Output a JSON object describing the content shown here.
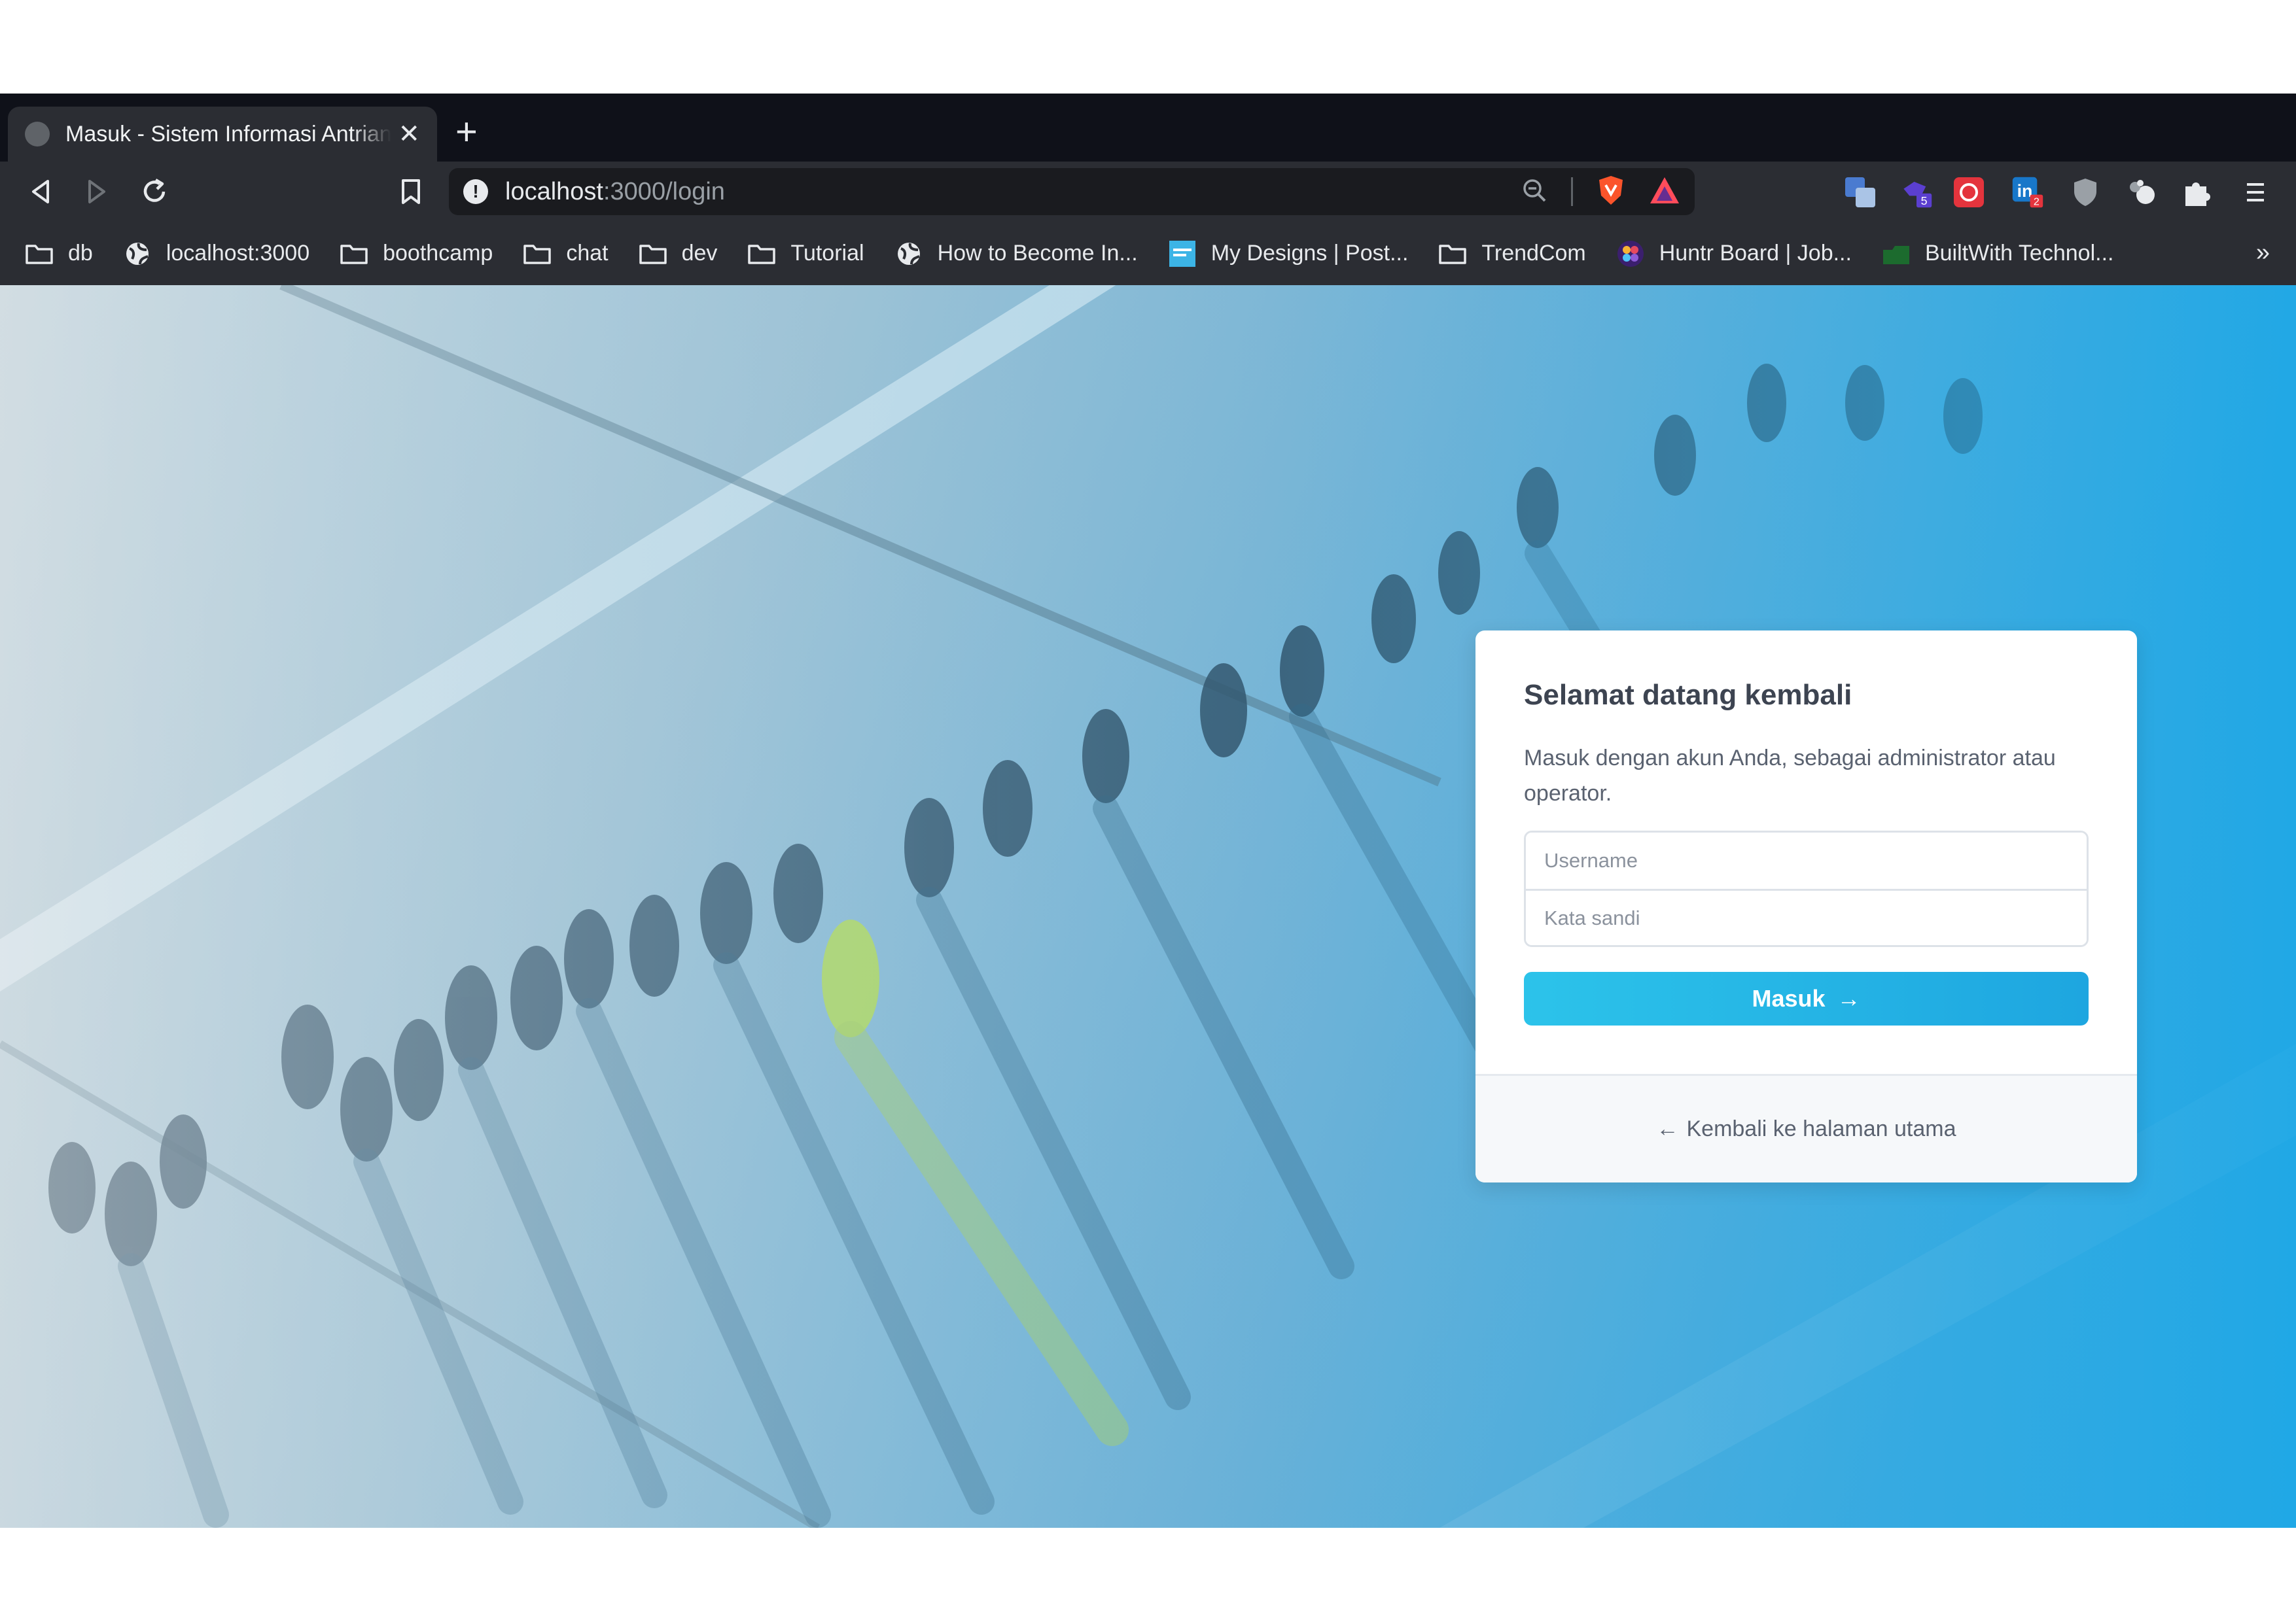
{
  "browser": {
    "tab": {
      "title": "Masuk - Sistem Informasi Antrian",
      "close": "✕"
    },
    "new_tab": "+",
    "address": {
      "host": "localhost",
      "path": ":3000/login"
    },
    "bookmarks": [
      {
        "label": "db",
        "icon": "folder-icon"
      },
      {
        "label": "localhost:3000",
        "icon": "globe-icon"
      },
      {
        "label": "boothcamp",
        "icon": "folder-icon"
      },
      {
        "label": "chat",
        "icon": "folder-icon"
      },
      {
        "label": "dev",
        "icon": "folder-icon"
      },
      {
        "label": "Tutorial",
        "icon": "folder-icon"
      },
      {
        "label": "How to Become In...",
        "icon": "globe-icon"
      },
      {
        "label": "My Designs | Post...",
        "icon": "postermywall-icon"
      },
      {
        "label": "TrendCom",
        "icon": "folder-icon"
      },
      {
        "label": "Huntr Board | Job...",
        "icon": "huntr-icon"
      },
      {
        "label": "BuiltWith Technol...",
        "icon": "builtwith-icon"
      }
    ],
    "bookmarks_more": "»",
    "extension_badges": {
      "ext2": "5",
      "linkedin": "2"
    }
  },
  "login": {
    "title": "Selamat datang kembali",
    "description": "Masuk dengan akun Anda, sebagai administrator atau operator.",
    "username_placeholder": "Username",
    "password_placeholder": "Kata sandi",
    "submit_label": "Masuk",
    "submit_arrow": "→",
    "back_arrow": "←",
    "back_label": "Kembali ke halaman utama"
  },
  "colors": {
    "accent": "#1ea6e0",
    "chrome_dark": "#2b2d33",
    "tabstrip": "#0f1119"
  }
}
